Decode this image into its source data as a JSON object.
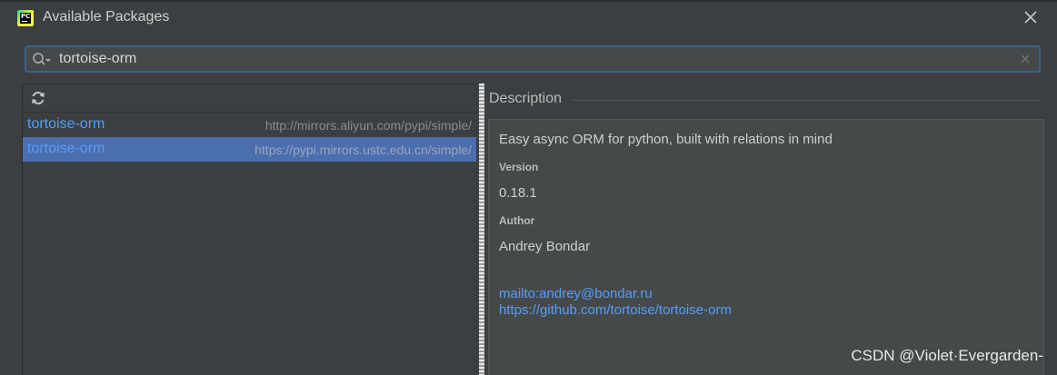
{
  "window": {
    "title": "Available Packages"
  },
  "search": {
    "value": "tortoise-orm",
    "placeholder": ""
  },
  "packages": [
    {
      "name": "tortoise-orm",
      "repo": "http://mirrors.aliyun.com/pypi/simple/",
      "selected": false
    },
    {
      "name": "tortoise-orm",
      "repo": "https://pypi.mirrors.ustc.edu.cn/simple/",
      "selected": true
    }
  ],
  "description": {
    "header": "Description",
    "summary": "Easy async ORM for python, built with relations in mind",
    "version_label": "Version",
    "version": "0.18.1",
    "author_label": "Author",
    "author": "Andrey Bondar",
    "links": [
      "mailto:andrey@bondar.ru",
      "https://github.com/tortoise/tortoise-orm"
    ]
  },
  "watermark": "CSDN @Violet·Evergarden-",
  "colors": {
    "background": "#3c3f41",
    "selection": "#4b6eaf",
    "link": "#589df6",
    "search_border": "#3d6185"
  },
  "icons": {
    "app": "pycharm-logo-icon",
    "close": "close-icon",
    "search": "search-icon",
    "clear": "clear-icon",
    "refresh": "refresh-icon"
  }
}
